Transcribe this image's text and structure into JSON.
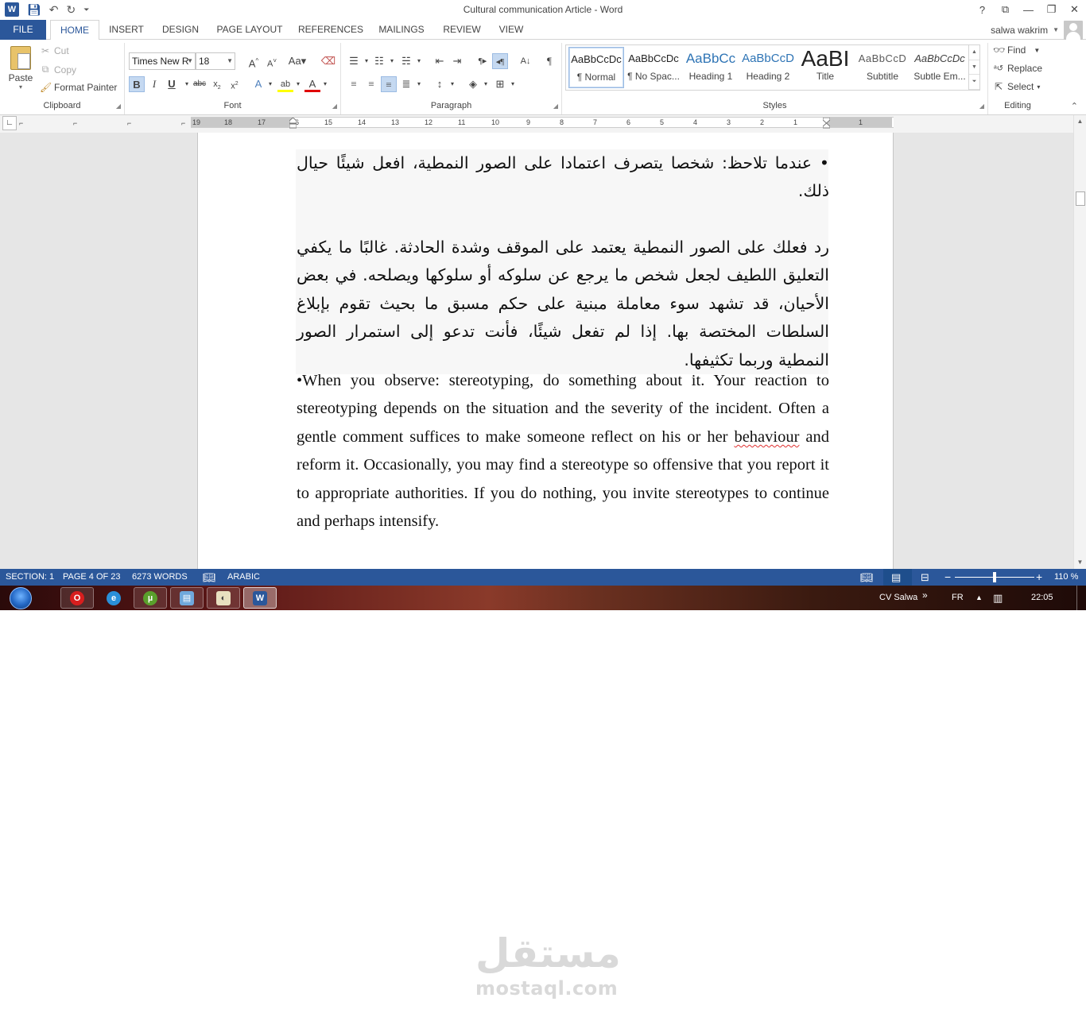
{
  "window": {
    "title": "Cultural communication Article - Word"
  },
  "qat": {
    "customize": "⏷"
  },
  "window_controls": {
    "help": "?",
    "ribbon_options": "⧉",
    "minimize": "—",
    "restore": "❐",
    "close": "✕"
  },
  "tabs": [
    {
      "label": "FILE"
    },
    {
      "label": "HOME"
    },
    {
      "label": "INSERT"
    },
    {
      "label": "DESIGN"
    },
    {
      "label": "PAGE LAYOUT"
    },
    {
      "label": "REFERENCES"
    },
    {
      "label": "MAILINGS"
    },
    {
      "label": "REVIEW"
    },
    {
      "label": "VIEW"
    }
  ],
  "user": {
    "name": "salwa wakrim"
  },
  "clipboard": {
    "group_label": "Clipboard",
    "paste": "Paste",
    "cut": "Cut",
    "copy": "Copy",
    "format_painter": "Format Painter"
  },
  "font": {
    "group_label": "Font",
    "family": "Times New R",
    "size": "18"
  },
  "paragraph": {
    "group_label": "Paragraph"
  },
  "styles": {
    "group_label": "Styles",
    "items": [
      {
        "preview": "AaBbCcDc",
        "name": "¶ Normal"
      },
      {
        "preview": "AaBbCcDc",
        "name": "¶ No Spac..."
      },
      {
        "preview": "AaBbCc",
        "name": "Heading 1"
      },
      {
        "preview": "AaBbCcD",
        "name": "Heading 2"
      },
      {
        "preview": "AaBI",
        "name": "Title"
      },
      {
        "preview": "AaBbCcD",
        "name": "Subtitle"
      },
      {
        "preview": "AaBbCcDc",
        "name": "Subtle Em..."
      }
    ]
  },
  "editing": {
    "group_label": "Editing",
    "find": "Find",
    "replace": "Replace",
    "select": "Select"
  },
  "ruler": {
    "numbers": [
      "19",
      "18",
      "17",
      "16",
      "15",
      "14",
      "13",
      "12",
      "11",
      "10",
      "9",
      "8",
      "7",
      "6",
      "5",
      "4",
      "3",
      "2",
      "1",
      "1"
    ]
  },
  "document": {
    "arabic_bullet": "• عندما تلاحظ: شخصا يتصرف اعتمادا على الصور النمطية، افعل شيئًا حيال ذلك.",
    "arabic_paragraph": "رد فعلك على الصور النمطية يعتمد على الموقف وشدة الحادثة. غالبًا ما يكفي التعليق اللطيف لجعل شخص ما يرجع عن سلوكه أو سلوكها ويصلحه. في بعض الأحيان، قد تشهد سوء معاملة مبنية على حكم مسبق ما بحيث تقوم بإبلاغ السلطات المختصة بها. إذا لم تفعل شيئًا، فأنت تدعو إلى استمرار الصور النمطية وربما تكثيفها.",
    "english_before": "•When you observe: stereotyping, do something about it. Your reaction to stereotyping depends on the situation and the severity of the incident. Often a gentle comment suffices to make someone reflect on his or her ",
    "english_misspelled": "behaviour",
    "english_after": " and reform it. Occasionally, you may find a stereotype so offensive that you report it to appropriate authorities. If you do nothing, you invite stereotypes to continue and perhaps intensify."
  },
  "status": {
    "section": "SECTION: 1",
    "page": "PAGE 4 OF 23",
    "words": "6273 WORDS",
    "language": "ARABIC",
    "zoom": "110 %",
    "zoom_minus": "−",
    "zoom_plus": "+"
  },
  "taskbar": {
    "tray_user": "CV Salwa",
    "tray_chevron": "»",
    "tray_lang": "FR",
    "clock": "22:05"
  },
  "watermark": {
    "arabic": "مستقل",
    "latin": "mostaql.com"
  }
}
